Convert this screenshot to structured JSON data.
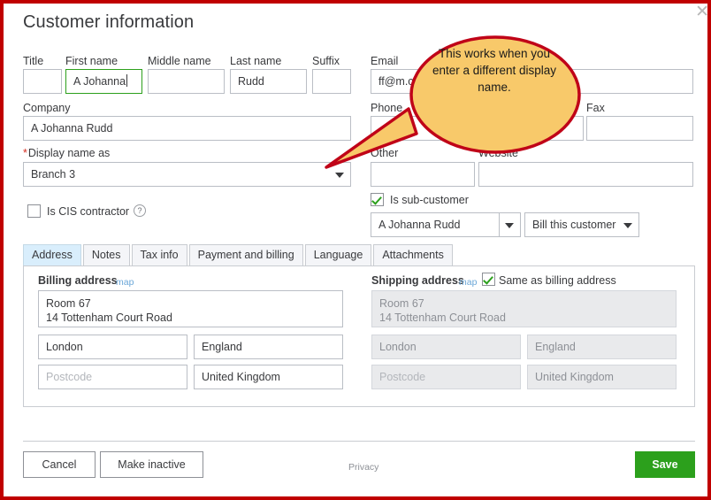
{
  "dialog": {
    "title": "Customer information",
    "close_icon": "close-icon"
  },
  "name_row": {
    "title": {
      "label": "Title",
      "value": ""
    },
    "first_name": {
      "label": "First name",
      "value": "A Johanna"
    },
    "middle_name": {
      "label": "Middle name",
      "value": ""
    },
    "last_name": {
      "label": "Last name",
      "value": "Rudd"
    },
    "suffix": {
      "label": "Suffix",
      "value": ""
    },
    "email": {
      "label": "Email",
      "value": "ff@m.co"
    }
  },
  "company_row": {
    "company": {
      "label": "Company",
      "value": "A Johanna Rudd"
    },
    "phone": {
      "label": "Phone",
      "value": ""
    },
    "fax": {
      "label": "Fax",
      "value": ""
    }
  },
  "display_row": {
    "display_name": {
      "label": "Display name as",
      "required_mark": "*",
      "value": "Branch 3"
    },
    "other": {
      "label": "Other",
      "value": ""
    },
    "website": {
      "label": "Website",
      "value": ""
    }
  },
  "cis": {
    "label": "Is CIS contractor",
    "checked": false,
    "help_icon": "?"
  },
  "sub_customer": {
    "label": "Is sub-customer",
    "checked": true,
    "parent_value": "A Johanna Rudd",
    "billing_option": "Bill this customer"
  },
  "tabs": [
    {
      "label": "Address",
      "active": true
    },
    {
      "label": "Notes",
      "active": false
    },
    {
      "label": "Tax info",
      "active": false
    },
    {
      "label": "Payment and billing",
      "active": false
    },
    {
      "label": "Language",
      "active": false
    },
    {
      "label": "Attachments",
      "active": false
    }
  ],
  "billing_address": {
    "title": "Billing address",
    "map_link": "map",
    "street": "Room 67\n14 Tottenham Court Road",
    "city": "London",
    "region": "England",
    "postcode_placeholder": "Postcode",
    "postcode": "",
    "country": "United Kingdom"
  },
  "shipping_address": {
    "title": "Shipping address",
    "map_link": "map",
    "same_as_billing_label": "Same as billing address",
    "same_as_billing_checked": true,
    "street": "Room 67\n14 Tottenham Court Road",
    "city": "London",
    "region": "England",
    "postcode_placeholder": "Postcode",
    "postcode": "",
    "country": "United Kingdom"
  },
  "footer": {
    "cancel": "Cancel",
    "make_inactive": "Make inactive",
    "privacy": "Privacy",
    "save": "Save"
  },
  "callout": {
    "text": "This works when you enter a different display name.",
    "fill_color": "#F8C96A",
    "border_color": "#C00418"
  },
  "colors": {
    "frame_red": "#C00000",
    "accent_green": "#2CA01C",
    "active_tab_blue": "#D9EEFC",
    "required_red": "#D52B1E",
    "link_blue": "#6BA7D8"
  }
}
